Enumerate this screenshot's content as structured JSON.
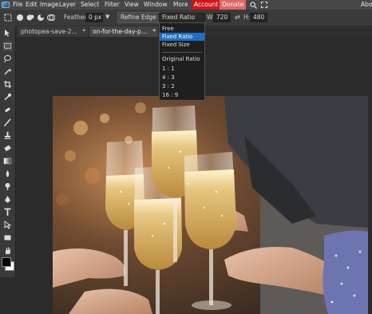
{
  "menu": {
    "items": [
      "File",
      "Edit",
      "Image",
      "Layer",
      "Select",
      "Filter",
      "View",
      "Window",
      "More"
    ],
    "account": "Account",
    "donate": "Donate",
    "about": "Abo"
  },
  "options": {
    "feather_label": "Feather:",
    "feather_value": "0 px",
    "refine_edge": "Refine Edge",
    "style_value": "Fixed Ratio",
    "w_label": "W:",
    "w_value": "720",
    "h_label": "H:",
    "h_value": "480"
  },
  "tabs": [
    {
      "label": "photopea-save-2...",
      "close": "*"
    },
    {
      "label": "on-for-the-day-p...",
      "close": "*"
    }
  ],
  "dropdown": {
    "items": [
      "Free",
      "Fixed Ratio",
      "Fixed Size"
    ],
    "selected": "Fixed Ratio",
    "section_label": "Original Ratio",
    "ratios": [
      "1 : 1",
      "4 : 3",
      "3 : 2",
      "16 : 9"
    ]
  },
  "colors": {
    "accent": "#1e6fc9",
    "account_bg": "#d0161c",
    "donate_bg": "#e06767",
    "menubar": "#474747",
    "panel": "#3a3a3a"
  },
  "icons": [
    "logo-icon",
    "rect-select-icon",
    "new-selection-icon",
    "add-selection-icon",
    "subtract-selection-icon",
    "intersect-selection-icon",
    "swap-icon",
    "search-icon",
    "fullscreen-icon"
  ]
}
